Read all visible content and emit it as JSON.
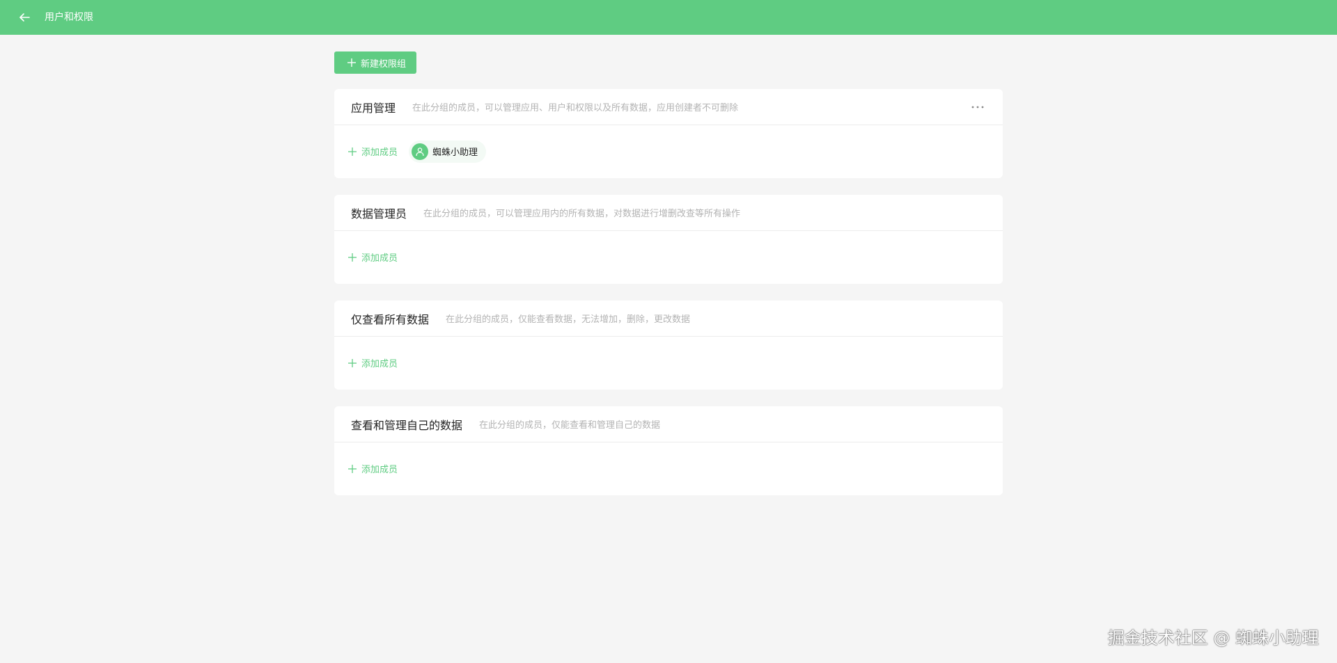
{
  "header": {
    "title": "用户和权限",
    "back_icon": "arrow-left-icon",
    "background_color": "#5fcc82"
  },
  "toolbar": {
    "new_group_label": "新建权限组"
  },
  "groups": [
    {
      "title": "应用管理",
      "description": "在此分组的成员，可以管理应用、用户和权限以及所有数据，应用创建者不可删除",
      "add_label": "添加成员",
      "members": [
        "蜘蛛小助理"
      ],
      "has_more_menu": true
    },
    {
      "title": "数据管理员",
      "description": "在此分组的成员，可以管理应用内的所有数据，对数据进行增删改查等所有操作",
      "add_label": "添加成员",
      "members": []
    },
    {
      "title": "仅查看所有数据",
      "description": "在此分组的成员，仅能查看数据，无法增加，删除，更改数据",
      "add_label": "添加成员",
      "members": []
    },
    {
      "title": "查看和管理自己的数据",
      "description": "在此分组的成员，仅能查看和管理自己的数据",
      "add_label": "添加成员",
      "members": []
    }
  ],
  "watermark": "掘金技术社区 @ 蜘蛛小助理",
  "colors": {
    "accent": "#5fcc82",
    "background": "#f5f5f5",
    "card": "#ffffff"
  }
}
